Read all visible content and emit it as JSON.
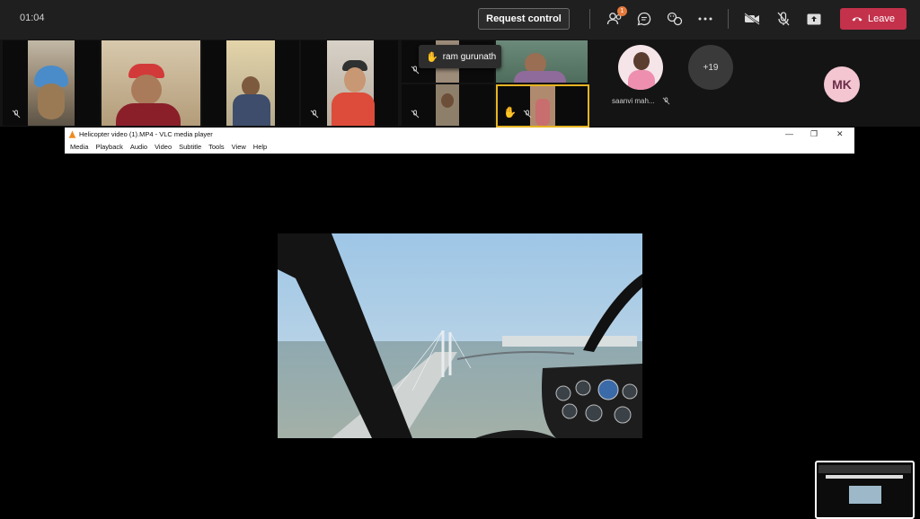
{
  "meeting": {
    "timer": "01:04",
    "request_control_label": "Request control",
    "leave_label": "Leave",
    "participants_badge": "1",
    "icons": [
      "participants-icon",
      "chat-icon",
      "reactions-icon",
      "more-icon",
      "camera-off-icon",
      "mic-off-icon",
      "share-icon"
    ]
  },
  "participants": {
    "hand_raised_name": "ram gurunath",
    "named_tile": "saanvi mah...",
    "overflow_count": "+19",
    "initials_avatar": "MK"
  },
  "vlc": {
    "title": "Helicopter video (1).MP4 - VLC media player",
    "menu": [
      "Media",
      "Playback",
      "Audio",
      "Video",
      "Subtitle",
      "Tools",
      "View",
      "Help"
    ]
  },
  "colors": {
    "leave": "#c4314b",
    "topbar": "#1f1f1f",
    "badge": "#e4793b",
    "hand_highlight": "#e6b422",
    "avatar_mk": "#f4c6d2"
  }
}
